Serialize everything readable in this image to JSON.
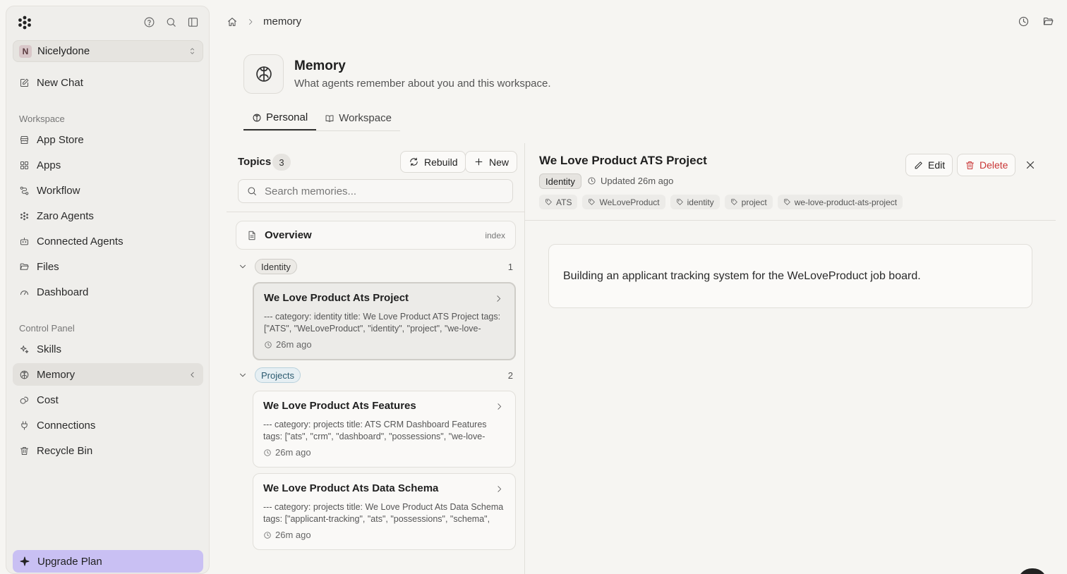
{
  "sidebar": {
    "workspace_initial": "N",
    "workspace_name": "Nicelydone",
    "new_chat": "New Chat",
    "workspace_section": "Workspace",
    "workspace_items": [
      "App Store",
      "Apps",
      "Workflow",
      "Zaro Agents",
      "Connected Agents",
      "Files",
      "Dashboard"
    ],
    "control_section": "Control Panel",
    "control_items": [
      "Skills",
      "Memory",
      "Cost",
      "Connections",
      "Recycle Bin"
    ],
    "upgrade": "Upgrade Plan"
  },
  "breadcrumb": {
    "current": "memory"
  },
  "header": {
    "title": "Memory",
    "subtitle": "What agents remember about you and this workspace.",
    "tabs": [
      "Personal",
      "Workspace"
    ]
  },
  "topics": {
    "label": "Topics",
    "count": "3",
    "rebuild": "Rebuild",
    "new": "New",
    "search_placeholder": "Search memories...",
    "overview_label": "Overview",
    "overview_meta": "index",
    "groups": [
      {
        "name": "Identity",
        "count": "1",
        "items": [
          {
            "title": "We Love Product Ats Project",
            "body": "--- category: identity title: We Love Product ATS Project tags: [\"ATS\", \"WeLoveProduct\", \"identity\", \"project\", \"we-love-product-...",
            "time": "26m ago"
          }
        ]
      },
      {
        "name": "Projects",
        "count": "2",
        "items": [
          {
            "title": "We Love Product Ats Features",
            "body": "--- category: projects title: ATS CRM Dashboard Features tags: [\"ats\", \"crm\", \"dashboard\", \"possessions\", \"we-love-product-ats-...",
            "time": "26m ago"
          },
          {
            "title": "We Love Product Ats Data Schema",
            "body": "--- category: projects title: We Love Product Ats Data Schema tags: [\"applicant-tracking\", \"ats\", \"possessions\", \"schema\", \"we-...",
            "time": "26m ago"
          }
        ]
      }
    ]
  },
  "detail": {
    "title": "We Love Product ATS Project",
    "category": "Identity",
    "updated": "Updated 26m ago",
    "tags": [
      "ATS",
      "WeLoveProduct",
      "identity",
      "project",
      "we-love-product-ats-project"
    ],
    "edit": "Edit",
    "delete": "Delete",
    "content": "Building an applicant tracking system for the WeLoveProduct job board."
  },
  "colors": {
    "background": "#f6f5f2",
    "upgrade": "#c9c0f3",
    "danger": "#c93636",
    "projects_pill": "#e6eff3"
  }
}
